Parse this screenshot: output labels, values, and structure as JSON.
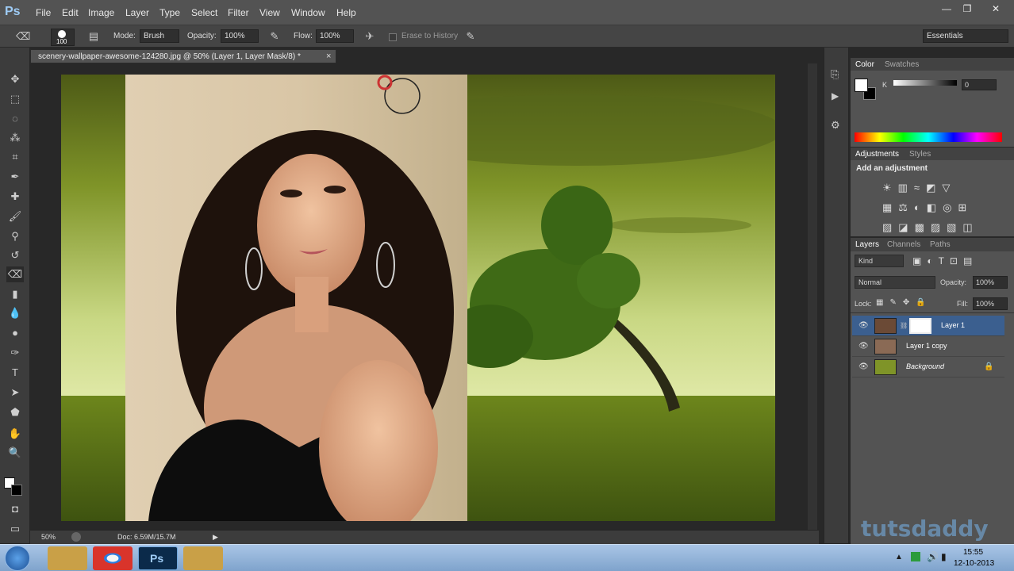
{
  "app": {
    "logo": "Ps"
  },
  "menu": [
    "File",
    "Edit",
    "Image",
    "Layer",
    "Type",
    "Select",
    "Filter",
    "View",
    "Window",
    "Help"
  ],
  "window_controls": [
    "—",
    "❐",
    "✕"
  ],
  "options": {
    "brush_size": "100",
    "mode_label": "Mode:",
    "mode_value": "Brush",
    "opacity_label": "Opacity:",
    "opacity_value": "100%",
    "flow_label": "Flow:",
    "flow_value": "100%",
    "erase_history": "Erase to History",
    "workspace": "Essentials"
  },
  "document": {
    "tab_title": "scenery-wallpaper-awesome-124280.jpg @ 50% (Layer 1, Layer Mask/8) *",
    "close": "×"
  },
  "status": {
    "zoom": "50%",
    "doc": "Doc: 6.59M/15.7M"
  },
  "color_panel": {
    "tabs": [
      "Color",
      "Swatches"
    ],
    "channel": "K",
    "value": "0"
  },
  "adjustments_panel": {
    "tabs": [
      "Adjustments",
      "Styles"
    ],
    "heading": "Add an adjustment"
  },
  "layers_panel": {
    "tabs": [
      "Layers",
      "Channels",
      "Paths"
    ],
    "filter": "Kind",
    "blend_mode": "Normal",
    "opacity_label": "Opacity:",
    "opacity_value": "100%",
    "lock_label": "Lock:",
    "fill_label": "Fill:",
    "fill_value": "100%",
    "layers": [
      {
        "name": "Layer 1",
        "selected": true
      },
      {
        "name": "Layer 1 copy",
        "selected": false
      },
      {
        "name": "Background",
        "selected": false
      }
    ]
  },
  "watermark": "tutsdaddy",
  "taskbar": {
    "time": "15:55",
    "date": "12-10-2013"
  },
  "colors": {
    "accent": "#3b5f8f",
    "chrome": "#535353",
    "canvas_bg": "#282828"
  }
}
